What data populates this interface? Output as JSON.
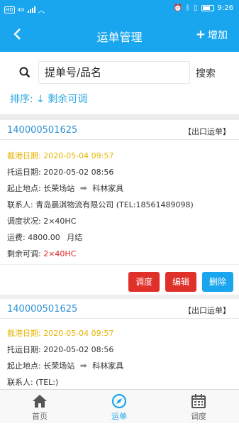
{
  "status_bar": {
    "network": "HD",
    "signal": "4G",
    "time": "9:26"
  },
  "header": {
    "back_icon": "back-icon",
    "title": "运单管理",
    "add_label": "增加"
  },
  "search": {
    "value": "提单号/品名",
    "button_label": "搜索"
  },
  "sort": {
    "label": "排序:",
    "arrow": "↓",
    "value": "剩余可调"
  },
  "waybills": [
    {
      "order_no": "140000501625",
      "tag": "【出口运单】",
      "cutoff_label": "截港日期:",
      "cutoff_date": "2020-05-04 09:57",
      "consign_label": "托运日期:",
      "consign_date": "2020-05-02 08:56",
      "route_label": "起止地点:",
      "origin": "长荣场站",
      "destination": "科林家具",
      "contact_label": "联系人:",
      "contact": "青岛晨淇物流有限公司 (TEL:18561489098)",
      "dispatch_label": "调度状况:",
      "dispatch": "2×40HC",
      "fee_label": "运费:",
      "fee": "4800.00",
      "pay_method": "月结",
      "remaining_label": "剩余可调:",
      "remaining": "2×40HC",
      "actions": {
        "dispatch": "调度",
        "edit": "编辑",
        "delete": "删除"
      }
    },
    {
      "order_no": "140000501625",
      "tag": "【出口运单】",
      "cutoff_label": "截港日期:",
      "cutoff_date": "2020-05-04 09:57",
      "consign_label": "托运日期:",
      "consign_date": "2020-05-02 08:56",
      "route_label": "起止地点:",
      "origin": "长荣场站",
      "destination": "科林家具",
      "contact_label": "联系人:",
      "contact": "(TEL:)"
    }
  ],
  "tabs": [
    {
      "label": "首页",
      "icon": "home-icon"
    },
    {
      "label": "运单",
      "icon": "compass-icon"
    },
    {
      "label": "调度",
      "icon": "calendar-icon"
    }
  ],
  "colors": {
    "primary": "#1aa6ee",
    "danger": "#e0302a",
    "highlight": "#e5b400",
    "link": "#2a8fd4"
  }
}
